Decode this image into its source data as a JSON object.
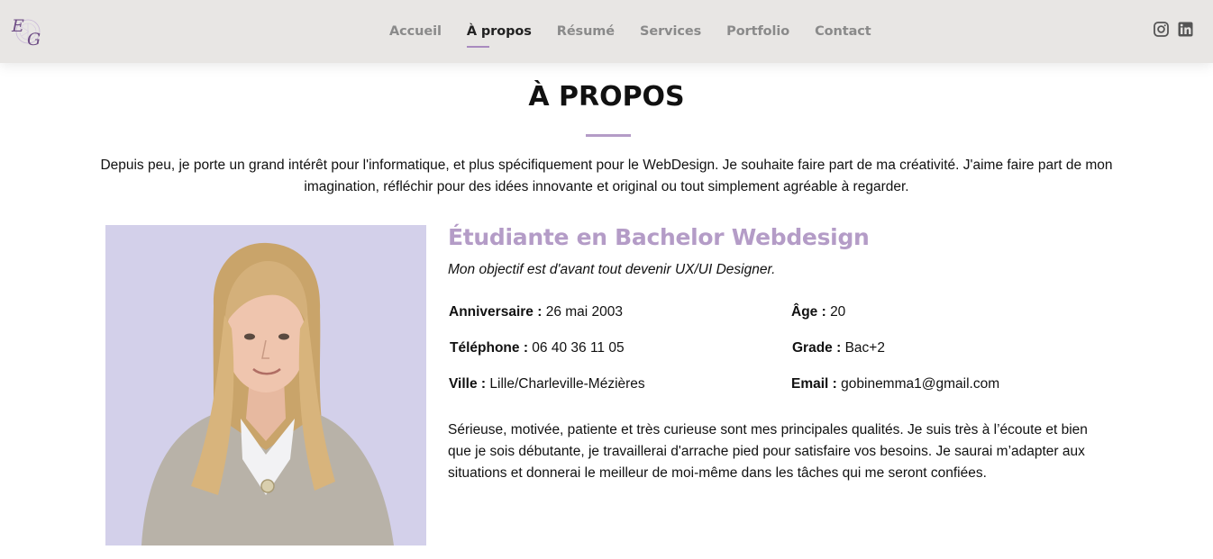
{
  "header": {
    "nav": [
      {
        "label": "Accueil",
        "active": false
      },
      {
        "label": "À propos",
        "active": true
      },
      {
        "label": "Résumé",
        "active": false
      },
      {
        "label": "Services",
        "active": false
      },
      {
        "label": "Portfolio",
        "active": false
      },
      {
        "label": "Contact",
        "active": false
      }
    ],
    "social_icons": [
      "instagram-icon",
      "linkedin-icon"
    ]
  },
  "section": {
    "title": "À PROPOS",
    "intro": "Depuis peu, je porte un grand intérêt pour l'informatique, et plus spécifiquement pour le WebDesign. Je souhaite faire part de ma créativité. J'aime faire part de mon imagination, réfléchir pour des idées innovante et original ou tout simplement agréable à regarder."
  },
  "profile": {
    "headline": "Étudiante en Bachelor Webdesign",
    "objective": "Mon objectif est d'avant tout devenir UX/UI Designer.",
    "birthday_label": "Anniversaire :",
    "birthday_value": "26 mai 2003",
    "phone_label": "Téléphone :",
    "phone_value": "06 40 36 11 05",
    "city_label": "Ville :",
    "city_value": "Lille/Charleville-Mézières",
    "age_label": "Âge :",
    "age_value": "20",
    "grade_label": "Grade :",
    "grade_value": "Bac+2",
    "email_label": "Email :",
    "email_value": "gobinemma1@gmail.com",
    "bio": "Sérieuse, motivée, patiente et très curieuse sont mes principales qualités. Je suis très à l’écoute et bien que je sois débutante, je travaillerai d'arrache pied pour satisfaire vos besoins. Je saurai m’adapter aux situations et donnerai le meilleur de moi-même dans les tâches qui me seront confiées."
  },
  "colors": {
    "accent": "#b49cc7",
    "header_bg": "#e8e6e4",
    "photo_bg": "#d3d0ea"
  }
}
